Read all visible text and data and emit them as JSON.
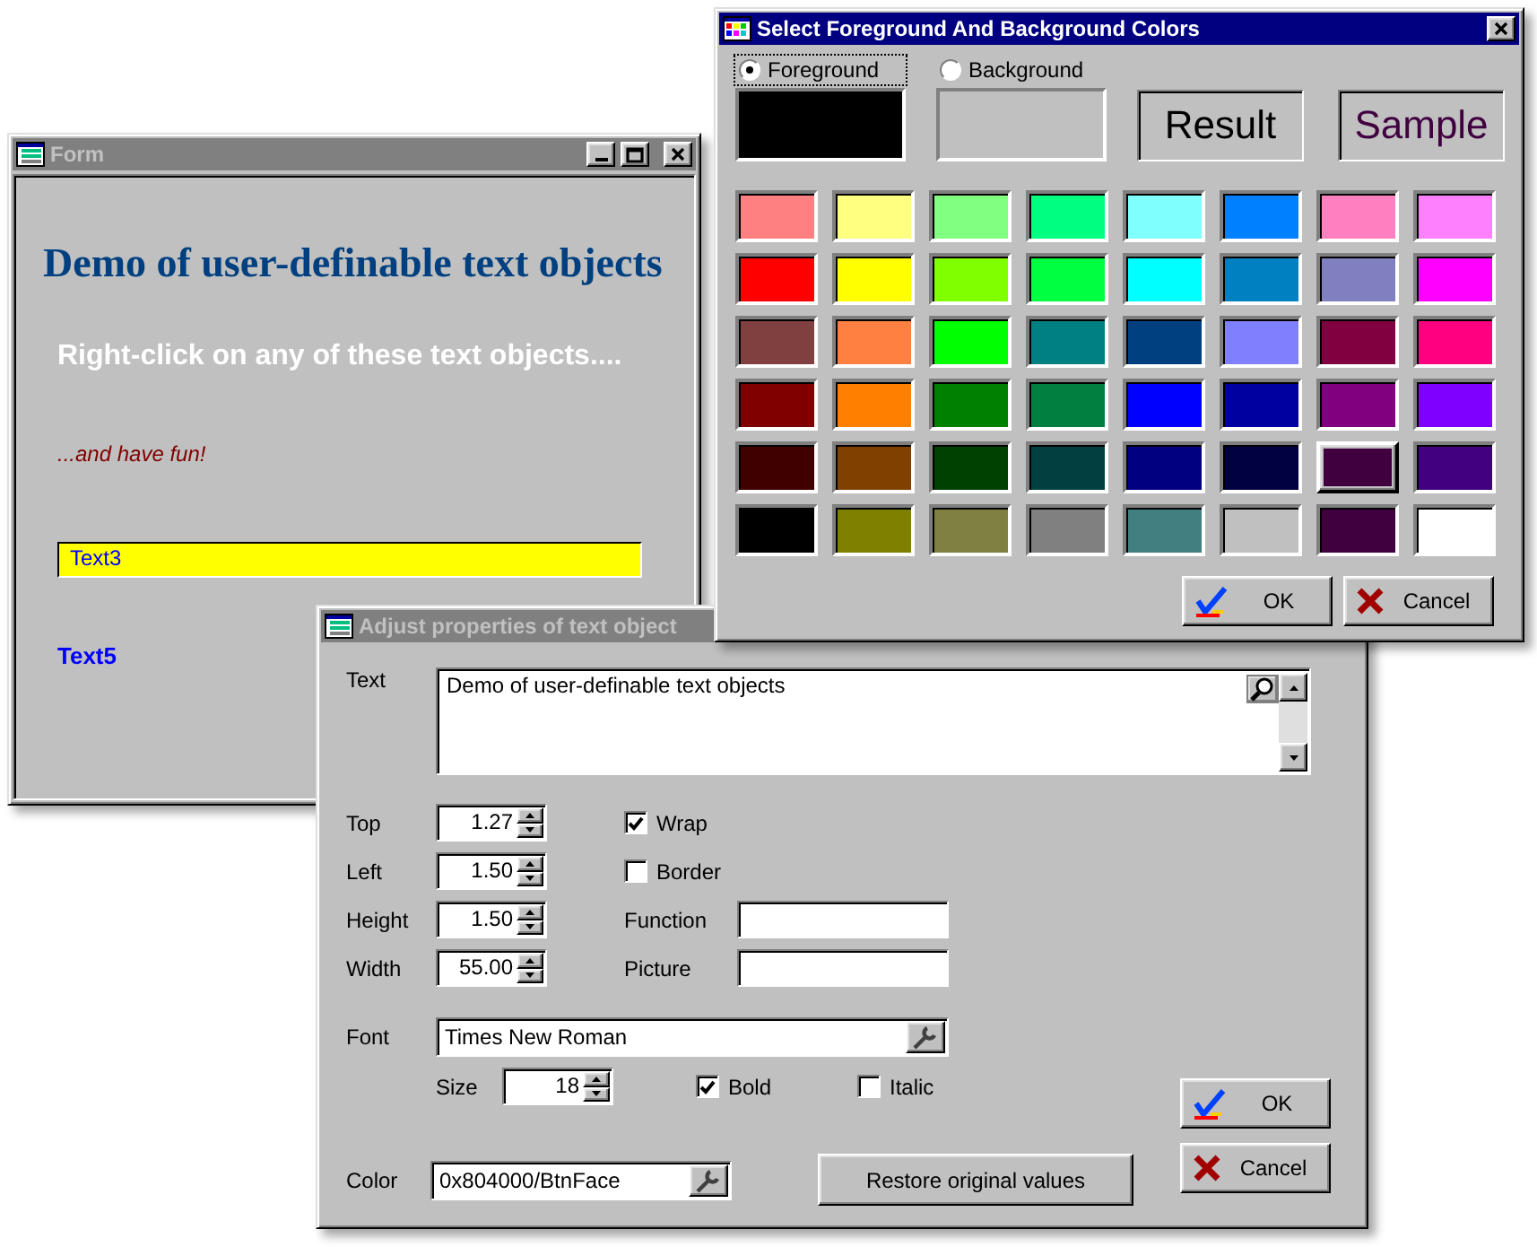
{
  "form_window": {
    "title": "Form",
    "active": false,
    "heading": "Demo of user-definable text objects",
    "instruction": "Right-click on any of these text objects....",
    "note": "...and have fun!",
    "text3": "Text3",
    "text5": "Text5"
  },
  "adjust_dialog": {
    "title": "Adjust properties of text object",
    "active": false,
    "text_label": "Text",
    "text_value": "Demo of user-definable text objects",
    "spin_fields": [
      {
        "label": "Top",
        "value": "1.27"
      },
      {
        "label": "Left",
        "value": "1.50"
      },
      {
        "label": "Height",
        "value": "1.50"
      },
      {
        "label": "Width",
        "value": "55.00"
      }
    ],
    "options": [
      {
        "kind": "checkbox",
        "label": "Wrap",
        "checked": true
      },
      {
        "kind": "checkbox",
        "label": "Border",
        "checked": false
      },
      {
        "kind": "field",
        "label": "Function"
      },
      {
        "kind": "field",
        "label": "Picture"
      }
    ],
    "font_label": "Font",
    "font_value": "Times New Roman",
    "size_label": "Size",
    "size_value": "18",
    "style_checks": [
      {
        "label": "Bold",
        "checked": true
      },
      {
        "label": "Italic",
        "checked": false
      }
    ],
    "color_label": "Color",
    "color_value": "0x804000/BtnFace",
    "restore_button": "Restore original values",
    "buttons": [
      {
        "kind": "ok",
        "label": "OK"
      },
      {
        "kind": "cancel",
        "label": "Cancel"
      }
    ]
  },
  "color_dialog": {
    "title": "Select Foreground And Background Colors",
    "active": true,
    "targets": [
      {
        "label": "Foreground",
        "selected": true,
        "color": "#000000"
      },
      {
        "label": "Background",
        "selected": false,
        "color": "#c0c0c0"
      }
    ],
    "result_label": "Result",
    "sample_label": "Sample",
    "palette": [
      {
        "swatches": [
          {
            "color": "#ff8080",
            "selected": false
          },
          {
            "color": "#ffff80",
            "selected": false
          },
          {
            "color": "#80ff80",
            "selected": false
          },
          {
            "color": "#00ff80",
            "selected": false
          },
          {
            "color": "#80ffff",
            "selected": false
          },
          {
            "color": "#0080ff",
            "selected": false
          },
          {
            "color": "#ff80c0",
            "selected": false
          },
          {
            "color": "#ff80ff",
            "selected": false
          }
        ]
      },
      {
        "swatches": [
          {
            "color": "#ff0000",
            "selected": false
          },
          {
            "color": "#ffff00",
            "selected": false
          },
          {
            "color": "#80ff00",
            "selected": false
          },
          {
            "color": "#00ff40",
            "selected": false
          },
          {
            "color": "#00ffff",
            "selected": false
          },
          {
            "color": "#0080c0",
            "selected": false
          },
          {
            "color": "#8080c0",
            "selected": false
          },
          {
            "color": "#ff00ff",
            "selected": false
          }
        ]
      },
      {
        "swatches": [
          {
            "color": "#804040",
            "selected": false
          },
          {
            "color": "#ff8040",
            "selected": false
          },
          {
            "color": "#00ff00",
            "selected": false
          },
          {
            "color": "#008080",
            "selected": false
          },
          {
            "color": "#004080",
            "selected": false
          },
          {
            "color": "#8080ff",
            "selected": false
          },
          {
            "color": "#800040",
            "selected": false
          },
          {
            "color": "#ff0080",
            "selected": false
          }
        ]
      },
      {
        "swatches": [
          {
            "color": "#800000",
            "selected": false
          },
          {
            "color": "#ff8000",
            "selected": false
          },
          {
            "color": "#008000",
            "selected": false
          },
          {
            "color": "#008040",
            "selected": false
          },
          {
            "color": "#0000ff",
            "selected": false
          },
          {
            "color": "#0000a0",
            "selected": false
          },
          {
            "color": "#800080",
            "selected": false
          },
          {
            "color": "#8000ff",
            "selected": false
          }
        ]
      },
      {
        "swatches": [
          {
            "color": "#400000",
            "selected": false
          },
          {
            "color": "#804000",
            "selected": false
          },
          {
            "color": "#004000",
            "selected": false
          },
          {
            "color": "#004040",
            "selected": false
          },
          {
            "color": "#000080",
            "selected": false
          },
          {
            "color": "#000040",
            "selected": false
          },
          {
            "color": "#400040",
            "selected": true
          },
          {
            "color": "#400080",
            "selected": false
          }
        ]
      },
      {
        "swatches": [
          {
            "color": "#000000",
            "selected": false
          },
          {
            "color": "#808000",
            "selected": false
          },
          {
            "color": "#808040",
            "selected": false
          },
          {
            "color": "#808080",
            "selected": false
          },
          {
            "color": "#408080",
            "selected": false
          },
          {
            "color": "#c0c0c0",
            "selected": false
          },
          {
            "color": "#400040",
            "selected": false
          },
          {
            "color": "#ffffff",
            "selected": false
          }
        ]
      }
    ],
    "buttons": [
      {
        "kind": "ok",
        "label": "OK"
      },
      {
        "kind": "cancel",
        "label": "Cancel"
      }
    ]
  }
}
